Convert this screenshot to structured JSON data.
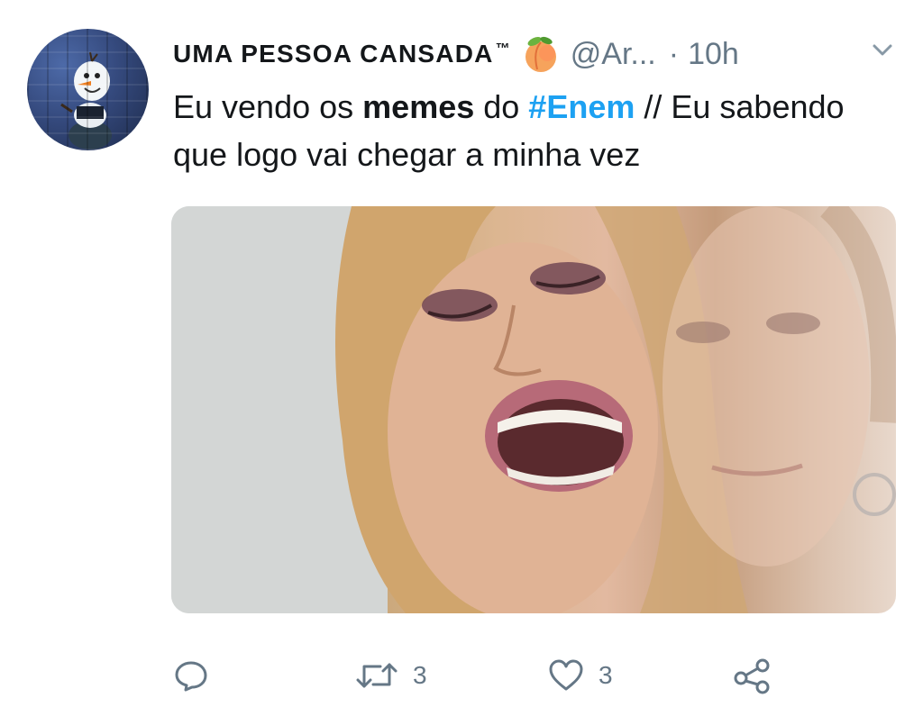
{
  "tweet": {
    "display_name": "UMA PESSOA CANSADA",
    "trademark": "™",
    "emoji": "peach-emoji",
    "handle": "@Ar...",
    "separator": "·",
    "time": "10h",
    "text_parts": {
      "p1": "Eu vendo os ",
      "memes": "memes",
      "p2": " do ",
      "hashtag": "#Enem",
      "p3": " // Eu sabendo que logo vai chegar a minha vez"
    },
    "media": {
      "description": "photo-meme"
    },
    "actions": {
      "reply_icon": "reply-icon",
      "retweet_icon": "retweet-icon",
      "retweet_count": "3",
      "like_icon": "heart-icon",
      "like_count": "3",
      "share_icon": "share-icon"
    },
    "colors": {
      "hashtag": "#1da1f2",
      "secondary_text": "#657786",
      "primary_text": "#14171a"
    }
  }
}
